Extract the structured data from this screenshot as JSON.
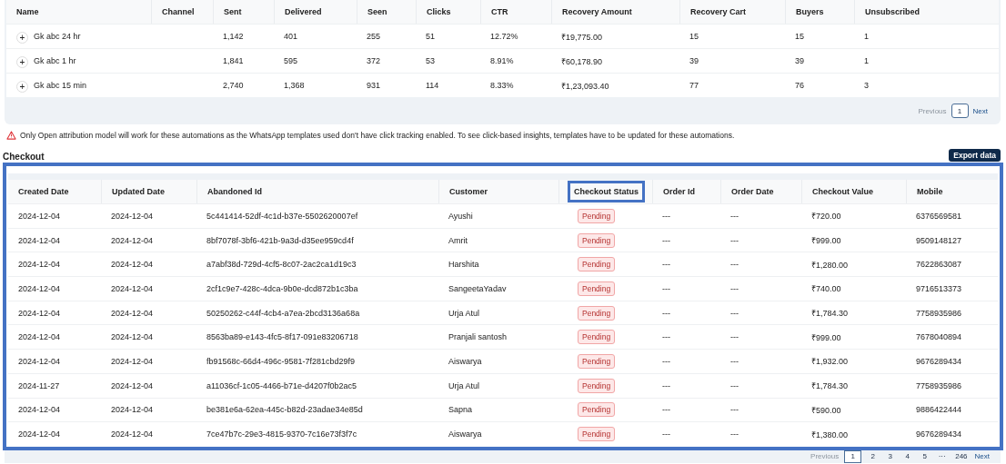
{
  "automations": {
    "columns": [
      "Name",
      "Channel",
      "Sent",
      "Delivered",
      "Seen",
      "Clicks",
      "CTR",
      "Recovery Amount",
      "Recovery Cart",
      "Buyers",
      "Unsubscribed"
    ],
    "rows": [
      {
        "expand": "+",
        "cells": [
          "Gk abc 24 hr",
          "",
          "1,142",
          "401",
          "255",
          "51",
          "12.72%",
          "₹19,775.00",
          "15",
          "15",
          "1"
        ]
      },
      {
        "expand": "+",
        "cells": [
          "Gk abc 1 hr",
          "",
          "1,841",
          "595",
          "372",
          "53",
          "8.91%",
          "₹60,178.90",
          "39",
          "39",
          "1"
        ]
      },
      {
        "expand": "+",
        "cells": [
          "Gk abc 15 min",
          "",
          "2,740",
          "1,368",
          "931",
          "114",
          "8.33%",
          "₹1,23,093.40",
          "77",
          "76",
          "3"
        ]
      }
    ],
    "pagination": {
      "previous": "Previous",
      "pages": [
        {
          "label": "1",
          "selected": true
        }
      ],
      "next": "Next"
    }
  },
  "warning": "Only Open attribution model will work for these automations as the WhatsApp templates used don't have click tracking enabled. To see click-based insights, templates have to be updated for these automations.",
  "checkout": {
    "title": "Checkout",
    "export_button": "Export data",
    "highlighted": true,
    "columns": [
      {
        "label": "Created Date",
        "highlighted": false
      },
      {
        "label": "Updated Date",
        "highlighted": false
      },
      {
        "label": "Abandoned Id",
        "highlighted": false
      },
      {
        "label": "Customer",
        "highlighted": false
      },
      {
        "label": "Checkout Status",
        "highlighted": true
      },
      {
        "label": "Order Id",
        "highlighted": false
      },
      {
        "label": "Order Date",
        "highlighted": false
      },
      {
        "label": "Checkout Value",
        "highlighted": false
      },
      {
        "label": "Mobile",
        "highlighted": false
      }
    ],
    "rows": [
      [
        "2024-12-04",
        "2024-12-04",
        "5c441414-52df-4c1d-b37e-5502620007ef",
        "Ayushi",
        "Pending",
        "---",
        "---",
        "₹720.00",
        "6376569581"
      ],
      [
        "2024-12-04",
        "2024-12-04",
        "8bf7078f-3bf6-421b-9a3d-d35ee959cd4f",
        "Amrit",
        "Pending",
        "---",
        "---",
        "₹999.00",
        "9509148127"
      ],
      [
        "2024-12-04",
        "2024-12-04",
        "a7abf38d-729d-4cf5-8c07-2ac2ca1d19c3",
        "Harshita",
        "Pending",
        "---",
        "---",
        "₹1,280.00",
        "7622863087"
      ],
      [
        "2024-12-04",
        "2024-12-04",
        "2cf1c9e7-428c-4dca-9b0e-dcd872b1c3ba",
        "SangeetaYadav",
        "Pending",
        "---",
        "---",
        "₹740.00",
        "9716513373"
      ],
      [
        "2024-12-04",
        "2024-12-04",
        "50250262-c44f-4cb4-a7ea-2bcd3136a68a",
        "Urja Atul",
        "Pending",
        "---",
        "---",
        "₹1,784.30",
        "7758935986"
      ],
      [
        "2024-12-04",
        "2024-12-04",
        "8563ba89-e143-4fc5-8f17-091e83206718",
        "Pranjali santosh",
        "Pending",
        "---",
        "---",
        "₹999.00",
        "7678040894"
      ],
      [
        "2024-12-04",
        "2024-12-04",
        "fb91568c-66d4-496c-9581-7f281cbd29f9",
        "Aiswarya",
        "Pending",
        "---",
        "---",
        "₹1,932.00",
        "9676289434"
      ],
      [
        "2024-11-27",
        "2024-12-04",
        "a11036cf-1c05-4466-b71e-d4207f0b2ac5",
        "Urja Atul",
        "Pending",
        "---",
        "---",
        "₹1,784.30",
        "7758935986"
      ],
      [
        "2024-12-04",
        "2024-12-04",
        "be381e6a-62ea-445c-b82d-23adae34e85d",
        "Sapna",
        "Pending",
        "---",
        "---",
        "₹590.00",
        "9886422444"
      ],
      [
        "2024-12-04",
        "2024-12-04",
        "7ce47b7c-29e3-4815-9370-7c16e73f3f7c",
        "Aiswarya",
        "Pending",
        "---",
        "---",
        "₹1,380.00",
        "9676289434"
      ]
    ],
    "pagination": {
      "previous": "Previous",
      "pages": [
        {
          "label": "1",
          "selected": true
        },
        {
          "label": "2",
          "selected": false
        },
        {
          "label": "3",
          "selected": false
        },
        {
          "label": "4",
          "selected": false
        },
        {
          "label": "5",
          "selected": false
        },
        {
          "label": "···",
          "selected": false
        },
        {
          "label": "246",
          "selected": false
        }
      ],
      "next": "Next"
    }
  }
}
